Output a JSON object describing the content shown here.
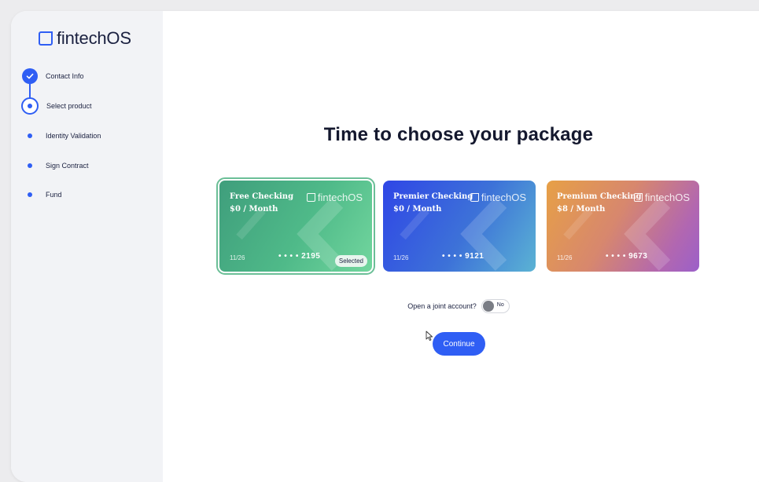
{
  "brand": {
    "name": "fintechOS",
    "accent": "#2f5ef4"
  },
  "steps": [
    {
      "label": "Contact Info",
      "state": "done"
    },
    {
      "label": "Select product",
      "state": "current"
    },
    {
      "label": "Identity Validation",
      "state": "pending"
    },
    {
      "label": "Sign Contract",
      "state": "pending"
    },
    {
      "label": "Fund",
      "state": "pending"
    }
  ],
  "main": {
    "title": "Time to choose your package",
    "cards": [
      {
        "name": "Free Checking",
        "price": "$0 / Month",
        "brand": "fintechOS",
        "expiry": "11/26",
        "number": "• • • • 2195",
        "badge": "Selected"
      },
      {
        "name": "Premier Checking",
        "price": "$0 / Month",
        "brand": "fintechOS",
        "expiry": "11/26",
        "number": "• • • • 9121"
      },
      {
        "name": "Premium Checking",
        "price": "$8 / Month",
        "brand": "fintechOS",
        "expiry": "11/26",
        "number": "• • • • 9673"
      }
    ],
    "joint_account": {
      "label": "Open a joint account?",
      "value": "No"
    },
    "continue_label": "Continue"
  }
}
